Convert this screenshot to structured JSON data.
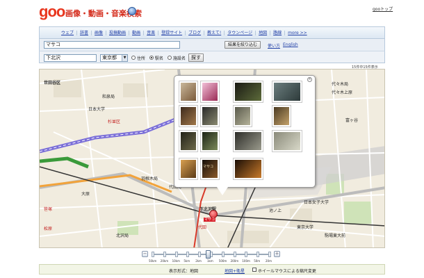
{
  "header": {
    "logo": "goo",
    "site_title": "画像・動画・音楽検索",
    "top_link": "gooトップ"
  },
  "nav": {
    "items": [
      "ウェブ",
      "辞書",
      "画像",
      "投稿動画",
      "動画",
      "音楽",
      "登録サイト",
      "ブログ",
      "教えて!",
      "タウンページ",
      "地図",
      "路線",
      "more >>"
    ]
  },
  "search": {
    "keyword": "マサコ",
    "refine_button": "結果を絞り込む",
    "help_link": "使い方",
    "english_link": "English"
  },
  "map_search": {
    "place": "下北沢",
    "prefecture": "東京都",
    "options": [
      "住所",
      "駅名",
      "施設名"
    ],
    "selected_option": "駅名",
    "search_button": "探す",
    "result_count": "15件中15件表示"
  },
  "map": {
    "labels": [
      {
        "text": "世田谷区",
        "style": "bold"
      },
      {
        "text": "代々木局",
        "style": ""
      },
      {
        "text": "和泉局",
        "style": ""
      },
      {
        "text": "杉並区",
        "style": "red"
      },
      {
        "text": "日本大学",
        "style": ""
      },
      {
        "text": "代田局",
        "style": ""
      },
      {
        "text": "羽根木局",
        "style": ""
      },
      {
        "text": "下北沢駅",
        "style": "bold"
      },
      {
        "text": "日本女子大学",
        "style": ""
      },
      {
        "text": "代々木上原",
        "style": ""
      },
      {
        "text": "東京大学",
        "style": ""
      },
      {
        "text": "駒場東大前",
        "style": ""
      },
      {
        "text": "富ヶ谷",
        "style": ""
      },
      {
        "text": "北沢局",
        "style": ""
      },
      {
        "text": "笹塚",
        "style": "red"
      },
      {
        "text": "大原",
        "style": ""
      },
      {
        "text": "松原",
        "style": "red"
      },
      {
        "text": "代田",
        "style": "red"
      },
      {
        "text": "池ノ上",
        "style": ""
      },
      {
        "text": "東北沢",
        "style": ""
      }
    ],
    "pin_label": "マサコ"
  },
  "popup": {
    "close": "×",
    "thumbnails": [
      {
        "colors": [
          "#c9b79a",
          "#7a5a3a"
        ],
        "label": ""
      },
      {
        "colors": [
          "#f2c0d8",
          "#9a2a55"
        ],
        "label": ""
      },
      {
        "colors": [
          "#1a1a14",
          "#5d6b3a"
        ],
        "label": ""
      },
      {
        "colors": [
          "#6b7d7e",
          "#2d3a3a"
        ],
        "label": ""
      },
      {
        "colors": [
          "#3e2a1c",
          "#a0784a"
        ],
        "label": ""
      },
      {
        "colors": [
          "#2a2a2a",
          "#8a8a70"
        ],
        "label": ""
      },
      {
        "colors": [
          "#5a5a4c",
          "#b5b39a"
        ],
        "label": ""
      },
      {
        "colors": [
          "#4a3a22",
          "#c4a26a"
        ],
        "label": ""
      },
      {
        "colors": [
          "#222218",
          "#6e6a4a"
        ],
        "label": ""
      },
      {
        "colors": [
          "#1c2416",
          "#7c8a5a"
        ],
        "label": ""
      },
      {
        "colors": [
          "#2e2e2a",
          "#9a9a8c"
        ],
        "label": ""
      },
      {
        "colors": [
          "#8a8a7a",
          "#d8d8c8"
        ],
        "label": ""
      },
      {
        "colors": [
          "#2a2e48",
          "#b8c0d8"
        ],
        "label": ""
      },
      {
        "colors": [
          "#cfcfc4",
          "#4a4a40"
        ],
        "label": ""
      },
      {
        "colors": [
          "#7a7a70",
          "#eaeae2"
        ],
        "label": ""
      },
      {
        "colors": [
          "#d6d0c8",
          "#6a625a"
        ],
        "label": ""
      },
      {
        "colors": [
          "#d9a050",
          "#5a3a16"
        ],
        "label": ""
      },
      {
        "colors": [
          "#140e08",
          "#8a5a2a"
        ],
        "label": "マサコ"
      },
      {
        "colors": [
          "#1a0e06",
          "#c87a2a"
        ],
        "label": ""
      }
    ]
  },
  "zoom": {
    "minus": "－",
    "plus": "＋",
    "scales": [
      "50km",
      "20km",
      "10km",
      "5km",
      "2km",
      "1km",
      "500m",
      "200m",
      "100m",
      "50m",
      "20m"
    ],
    "level": 0.47
  },
  "display_mode": {
    "label": "表示形式：地図",
    "link": "地図+衛星",
    "wheel_label": "ホイールマウスによる縮尺変更"
  }
}
